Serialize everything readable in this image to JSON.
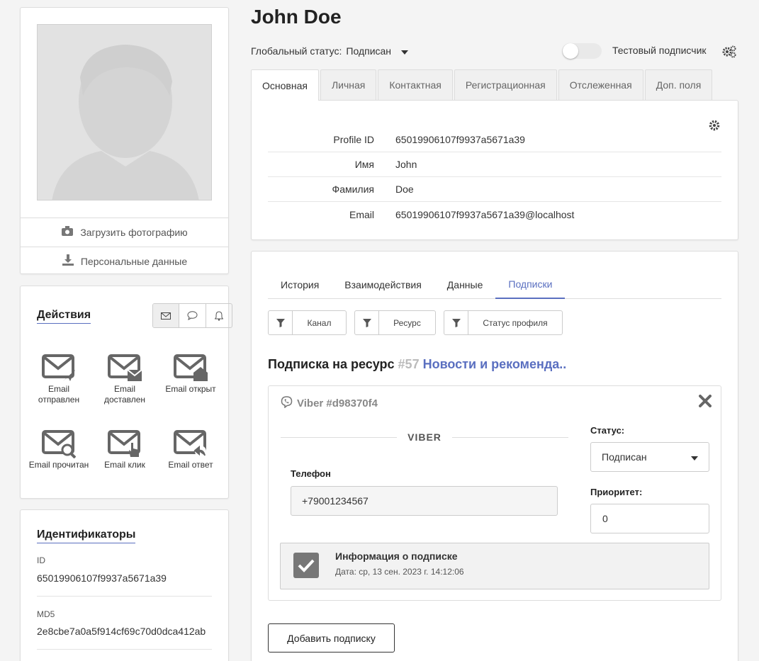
{
  "profile": {
    "upload_photo": "Загрузить фотографию",
    "personal_data": "Персональные данные"
  },
  "actions": {
    "title": "Действия",
    "icons": [
      "envelope-icon",
      "chat-bubble-icon",
      "bell-icon"
    ],
    "items": [
      {
        "label": "Email отправлен",
        "icon": "email-sent-icon"
      },
      {
        "label": "Email доставлен",
        "icon": "email-delivered-icon"
      },
      {
        "label": "Email открыт",
        "icon": "email-opened-icon"
      },
      {
        "label": "Email прочитан",
        "icon": "email-read-icon"
      },
      {
        "label": "Email клик",
        "icon": "email-click-icon"
      },
      {
        "label": "Email ответ",
        "icon": "email-reply-icon"
      }
    ]
  },
  "identifiers": {
    "title": "Идентификаторы",
    "items": [
      {
        "label": "ID",
        "value": "65019906107f9937a5671a39"
      },
      {
        "label": "MD5",
        "value": "2e8cbe7a0a5f914cf69c70d0dca412ab"
      }
    ]
  },
  "header": {
    "name": "John Doe",
    "global_status_label": "Глобальный статус:",
    "global_status_value": "Подписан",
    "test_subscriber_label": "Тестовый подписчик"
  },
  "tabs": [
    "Основная",
    "Личная",
    "Контактная",
    "Регистрационная",
    "Отслеженная",
    "Доп. поля"
  ],
  "main_info": [
    {
      "key": "Profile ID",
      "value": "65019906107f9937a5671a39"
    },
    {
      "key": "Имя",
      "value": "John"
    },
    {
      "key": "Фамилия",
      "value": "Doe"
    },
    {
      "key": "Email",
      "value": "65019906107f9937a5671a39@localhost"
    }
  ],
  "subtabs": [
    "История",
    "Взаимодействия",
    "Данные",
    "Подписки"
  ],
  "filters": [
    "Канал",
    "Ресурс",
    "Статус профиля"
  ],
  "subscription": {
    "title": "Подписка на ресурс",
    "number": "#57",
    "resource": "Новости и рекоменда..",
    "channel_title": "Viber #d98370f4",
    "divider_label": "VIBER",
    "phone_label": "Телефон",
    "phone_value": "+79001234567",
    "status_label": "Статус:",
    "status_value": "Подписан",
    "priority_label": "Приоритет:",
    "priority_value": "0",
    "info_title": "Информация о подписке",
    "info_date": "Дата: ср, 13 сен. 2023 г. 14:12:06"
  },
  "add_subscription": "Добавить подписку"
}
